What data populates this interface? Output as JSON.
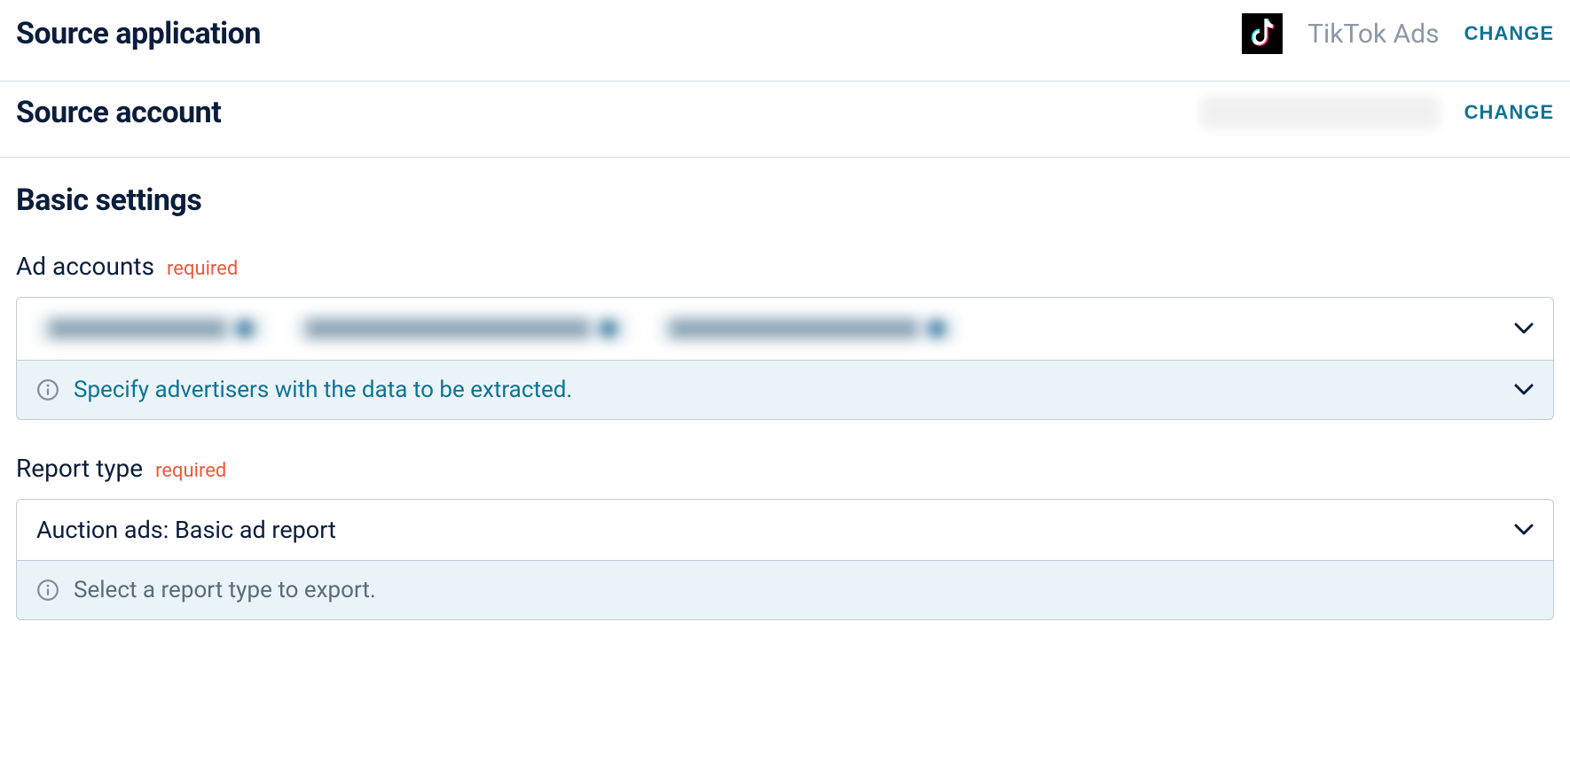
{
  "source_application": {
    "title": "Source application",
    "app_name": "TikTok Ads",
    "change_label": "CHANGE"
  },
  "source_account": {
    "title": "Source account",
    "change_label": "CHANGE"
  },
  "basic_settings": {
    "title": "Basic settings",
    "ad_accounts": {
      "label": "Ad accounts",
      "required": "required",
      "info": "Specify advertisers with the data to be extracted."
    },
    "report_type": {
      "label": "Report type",
      "required": "required",
      "value": "Auction ads: Basic ad report",
      "info": "Select a report type to export."
    }
  }
}
